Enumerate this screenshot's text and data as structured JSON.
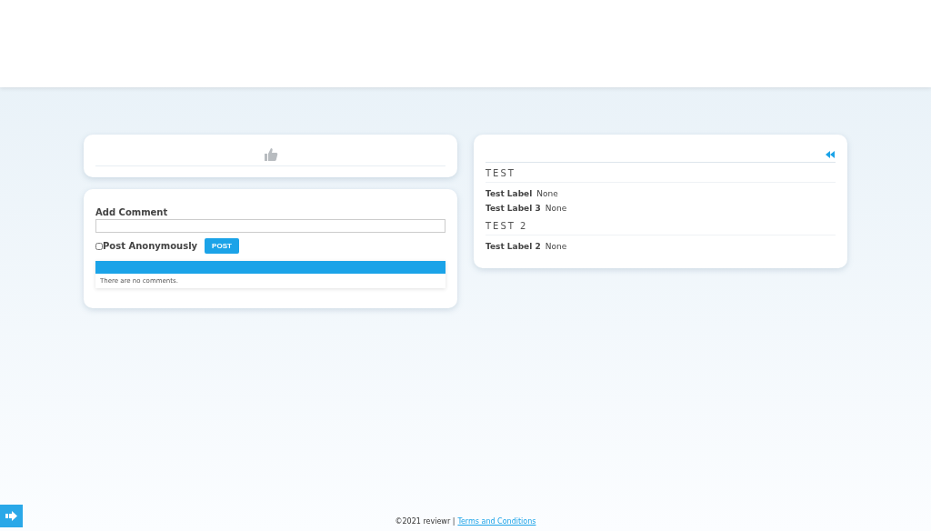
{
  "like_panel": {
    "liked": false
  },
  "comment_form": {
    "label": "Add Comment",
    "anonymous": {
      "label": "Post Anonymously",
      "checked": false
    },
    "submit": "POST",
    "empty_message": "There are no comments."
  },
  "details": {
    "sections": [
      {
        "title": "TEST",
        "fields": [
          {
            "label": "Test Label",
            "value": "None"
          },
          {
            "label": "Test Label 3",
            "value": "None"
          }
        ]
      },
      {
        "title": "TEST 2",
        "fields": [
          {
            "label": "Test Label 2",
            "value": "None"
          }
        ]
      }
    ]
  },
  "footer": {
    "copyright": "©2021 reviewr |",
    "link": "Terms and Conditions"
  }
}
